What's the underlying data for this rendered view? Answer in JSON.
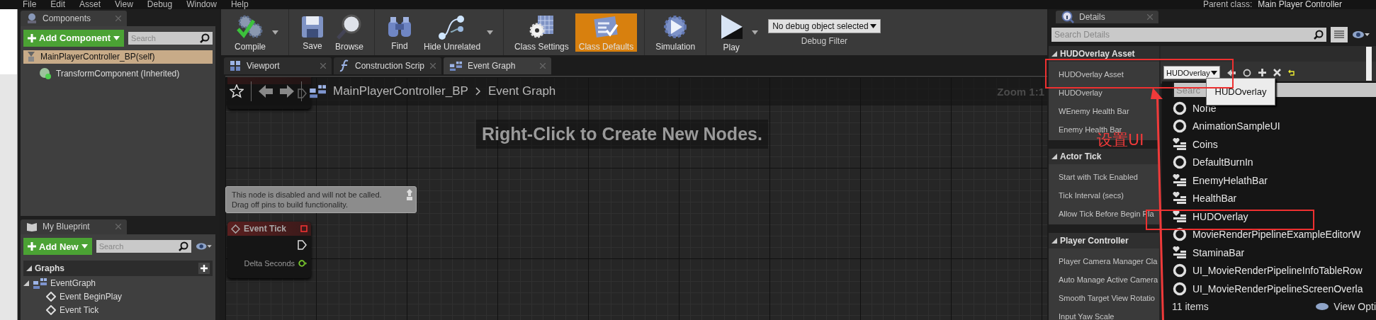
{
  "menu_bar": {
    "items": [
      "File",
      "Edit",
      "Asset",
      "View",
      "Debug",
      "Window",
      "Help"
    ],
    "parent_class_label": "Parent class:",
    "parent_class": "Main Player Controller"
  },
  "components_panel": {
    "tab": "Components",
    "add_button": "Add Component",
    "search_placeholder": "Search",
    "tree": [
      {
        "label": "MainPlayerController_BP(self)",
        "selected": true,
        "children": [
          {
            "label": "TransformComponent (Inherited)",
            "selected": false
          }
        ]
      }
    ]
  },
  "my_blueprint_panel": {
    "tab": "My Blueprint",
    "add_button": "Add New",
    "search_placeholder": "Search",
    "sections": [
      {
        "title": "Graphs",
        "expanded": true,
        "items": [
          {
            "label": "EventGraph",
            "expanded": true,
            "children": [
              {
                "label": "Event BeginPlay"
              },
              {
                "label": "Event Tick"
              }
            ]
          }
        ]
      }
    ]
  },
  "toolbar": {
    "groups": [
      [
        {
          "label": "Compile",
          "kind": "compile",
          "dropdown": true,
          "active": false
        }
      ],
      [
        {
          "label": "Save",
          "kind": "save",
          "dropdown": false,
          "active": false
        },
        {
          "label": "Browse",
          "kind": "browse",
          "dropdown": false,
          "active": false
        }
      ],
      [
        {
          "label": "Find",
          "kind": "find",
          "dropdown": false,
          "active": false
        },
        {
          "label": "Hide Unrelated",
          "kind": "hide",
          "dropdown": true,
          "active": false
        }
      ],
      [
        {
          "label": "Class Settings",
          "kind": "settings",
          "dropdown": false,
          "active": false
        },
        {
          "label": "Class Defaults",
          "kind": "defaults",
          "dropdown": false,
          "active": true
        }
      ],
      [
        {
          "label": "Simulation",
          "kind": "simulation",
          "dropdown": false,
          "active": false
        }
      ],
      [
        {
          "label": "Play",
          "kind": "play",
          "dropdown": true,
          "active": false
        }
      ]
    ],
    "debug_filter": {
      "value": "No debug object selected",
      "label": "Debug Filter"
    }
  },
  "document_tabs": [
    {
      "label": "Viewport",
      "kind": "viewport",
      "selected": false
    },
    {
      "label": "Construction Scrip",
      "kind": "function",
      "selected": false
    },
    {
      "label": "Event Graph",
      "kind": "graph",
      "selected": true
    }
  ],
  "graph": {
    "breadcrumb": [
      "MainPlayerController_BP",
      "Event Graph"
    ],
    "zoom": "Zoom 1:1",
    "hint": "Right-Click to Create New Nodes.",
    "comment": "This node is disabled and will not be called.\nDrag off pins to build functionality.",
    "node": {
      "title": "Event Tick",
      "output_pin": "Delta Seconds"
    }
  },
  "details": {
    "tab": "Details",
    "search_placeholder": "Search Details",
    "sections": [
      {
        "title": "HUDOverlay Asset",
        "expanded": true,
        "rows": [
          "HUDOverlay Asset",
          "HUDOverlay",
          "WEnemy Health Bar",
          "Enemy Health Bar"
        ]
      },
      {
        "title": "Actor Tick",
        "expanded": true,
        "rows": [
          "Start with Tick Enabled",
          "Tick Interval (secs)",
          "Allow Tick Before Begin Pla"
        ]
      },
      {
        "title": "Player Controller",
        "expanded": true,
        "rows": [
          "Player Camera Manager Cla",
          "Auto Manage Active Camera",
          "Smooth Target View Rotatio",
          "Input Yaw Scale"
        ]
      }
    ],
    "asset_value": "HUDOverlay",
    "tooltip": "HUDOverlay",
    "picker": {
      "search_placeholder": "Searc",
      "items": [
        {
          "label": "None",
          "kind": "blueprint"
        },
        {
          "label": "AnimationSampleUI",
          "kind": "blueprint"
        },
        {
          "label": "Coins",
          "kind": "widget"
        },
        {
          "label": "DefaultBurnIn",
          "kind": "blueprint"
        },
        {
          "label": "EnemyHelathBar",
          "kind": "widget"
        },
        {
          "label": "HealthBar",
          "kind": "widget"
        },
        {
          "label": "HUDOverlay",
          "kind": "widget"
        },
        {
          "label": "MovieRenderPipelineExampleEditorW",
          "kind": "blueprint"
        },
        {
          "label": "StaminaBar",
          "kind": "widget"
        },
        {
          "label": "UI_MovieRenderPipelineInfoTableRow",
          "kind": "blueprint"
        },
        {
          "label": "UI_MovieRenderPipelineScreenOverla",
          "kind": "blueprint"
        }
      ],
      "count": "11 items",
      "view_options": "View Opti"
    }
  },
  "annotation": {
    "text": "设置UI"
  }
}
